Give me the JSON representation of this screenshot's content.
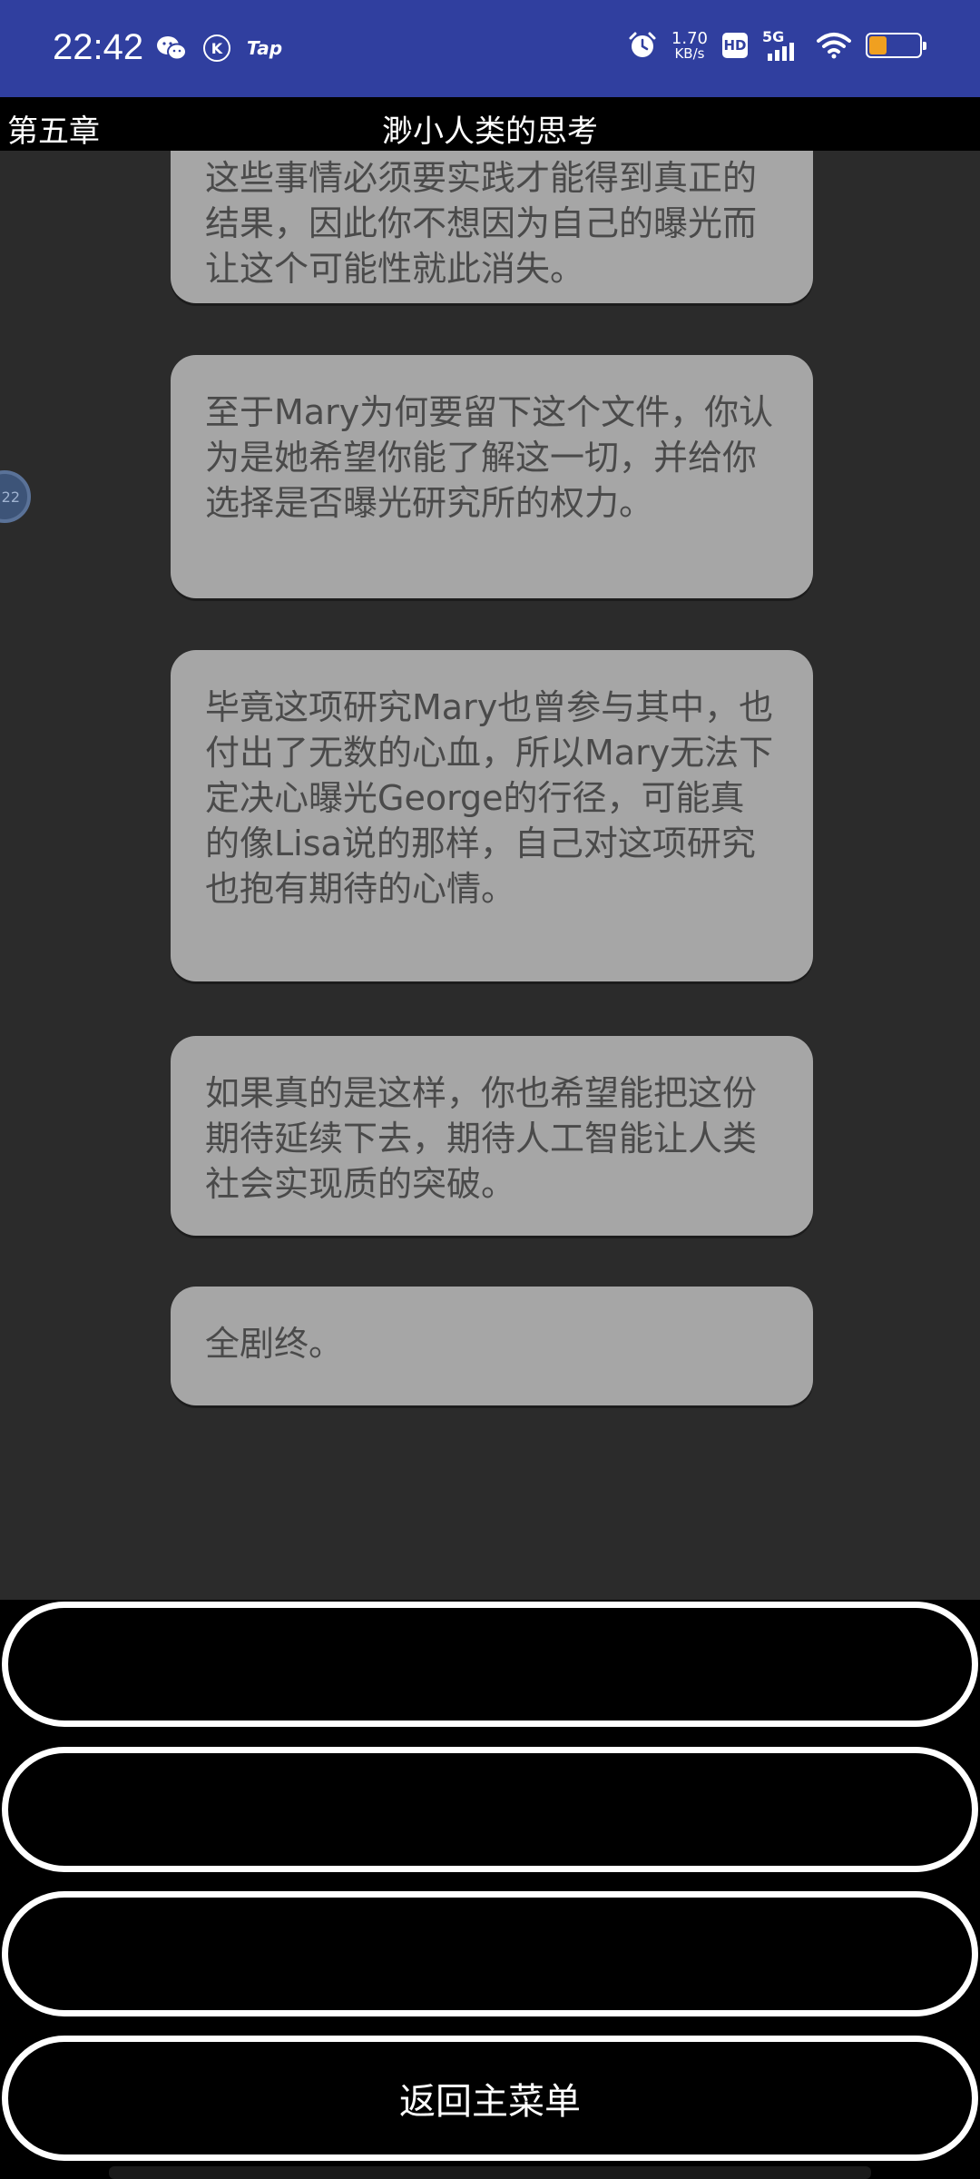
{
  "status_bar": {
    "time": "22:42",
    "tap_label": "Tap",
    "k_label": "K",
    "net_speed_value": "1.70",
    "net_speed_unit": "KB/s",
    "hd_label": "HD",
    "network_label": "5G",
    "battery_level": 0.35,
    "color": "#303f9f",
    "icons_left": [
      "wechat-icon",
      "k-app-icon",
      "tap-app-icon"
    ],
    "icons_right": [
      "alarm-icon",
      "hd-icon",
      "signal-5g-icon",
      "wifi-icon",
      "battery-icon"
    ]
  },
  "header": {
    "chapter": "第五章",
    "title": "渺小人类的思考"
  },
  "story": {
    "paragraphs": [
      "这些事情必须要实践才能得到真正的结果，因此你不想因为自己的曝光而让这个可能性就此消失。",
      "至于Mary为何要留下这个文件，你认为是她希望你能了解这一切，并给你选择是否曝光研究所的权力。",
      "毕竟这项研究Mary也曾参与其中，也付出了无数的心血，所以Mary无法下定决心曝光George的行径，可能真的像Lisa说的那样，自己对这项研究也抱有期待的心情。",
      "如果真的是这样，你也希望能把这份期待延续下去，期待人工智能让人类社会实现质的突破。",
      "全剧终。"
    ],
    "floating_badge_text": "22"
  },
  "choices": [
    {
      "label": ""
    },
    {
      "label": ""
    },
    {
      "label": ""
    },
    {
      "label": "返回主菜单"
    }
  ]
}
